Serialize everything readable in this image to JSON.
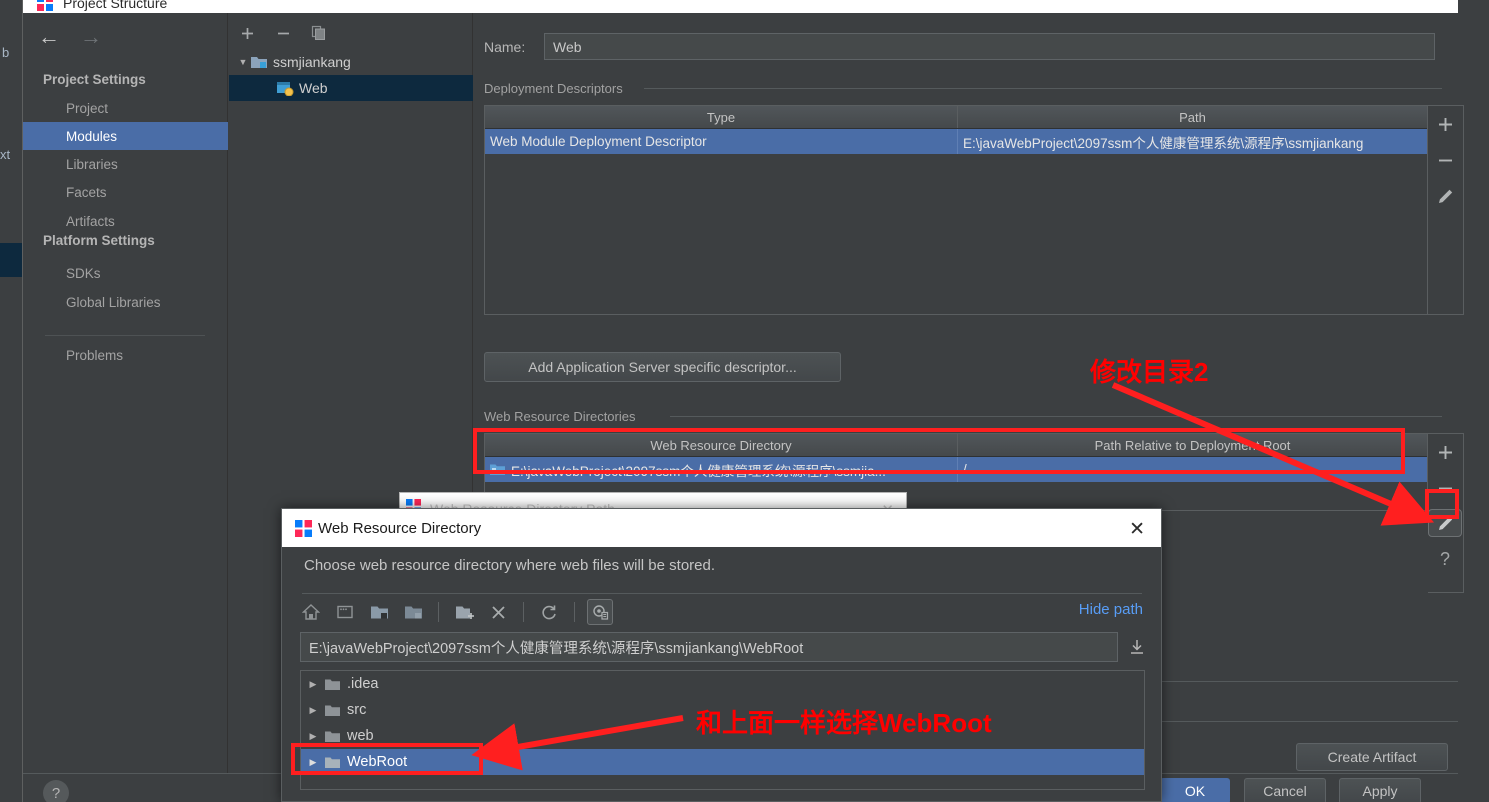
{
  "window": {
    "title": "Project Structure",
    "title_icon": "intellij-logo-icon"
  },
  "background_slivers": {
    "text_b": "b",
    "text_xt": "xt"
  },
  "nav": {
    "back_icon": "arrow-left-icon",
    "forward_icon": "arrow-right-icon",
    "groups": [
      {
        "label": "Project Settings"
      },
      {
        "label": "Platform Settings"
      }
    ],
    "items": [
      {
        "label": "Project",
        "selected": false
      },
      {
        "label": "Modules",
        "selected": true
      },
      {
        "label": "Libraries",
        "selected": false
      },
      {
        "label": "Facets",
        "selected": false
      },
      {
        "label": "Artifacts",
        "selected": false
      },
      {
        "label": "SDKs",
        "selected": false
      },
      {
        "label": "Global Libraries",
        "selected": false
      },
      {
        "label": "Problems",
        "selected": false
      }
    ]
  },
  "modules_panel": {
    "toolbar": [
      {
        "icon": "add-icon",
        "label": "+"
      },
      {
        "icon": "remove-icon",
        "label": "−"
      },
      {
        "icon": "copy-icon",
        "label": ""
      }
    ],
    "tree": [
      {
        "label": "ssmjiankang",
        "icon": "module-folder-icon",
        "expanded": true,
        "selected": false
      },
      {
        "label": "Web",
        "icon": "web-facet-icon",
        "expanded": false,
        "selected": true
      }
    ]
  },
  "content": {
    "name_label": "Name:",
    "name_value": "Web",
    "deployment_descriptors": {
      "section_label": "Deployment Descriptors",
      "columns": [
        "Type",
        "Path"
      ],
      "rows": [
        {
          "type": "Web Module Deployment Descriptor",
          "path": "E:\\javaWebProject\\2097ssm个人健康管理系统\\源程序\\ssmjiankang",
          "selected": true
        }
      ],
      "side_buttons": [
        {
          "icon": "plus-icon",
          "label": "+"
        },
        {
          "icon": "minus-icon",
          "label": "−"
        },
        {
          "icon": "pencil-icon",
          "label": ""
        }
      ]
    },
    "add_descriptor_button": "Add Application Server specific descriptor...",
    "web_resource_directories": {
      "section_label": "Web Resource Directories",
      "columns": [
        "Web Resource Directory",
        "Path Relative to Deployment Root"
      ],
      "rows": [
        {
          "directory": "E:\\javaWebProject\\2097ssm个人健康管理系统\\源程序\\ssmjia...",
          "relative_path": "/",
          "selected": true
        }
      ],
      "side_buttons": [
        {
          "icon": "plus-icon",
          "label": "+"
        },
        {
          "icon": "minus-icon",
          "label": "−"
        },
        {
          "icon": "pencil-icon",
          "label": ""
        },
        {
          "icon": "help-icon",
          "label": "?"
        }
      ]
    },
    "create_artifact_button": "Create Artifact"
  },
  "footer": {
    "help_icon": "question-circle-icon",
    "ok_button": "OK",
    "cancel_button": "Cancel",
    "apply_button": "Apply"
  },
  "background_dialog": {
    "title": "Web Resource Directory Path",
    "close_icon": "close-icon"
  },
  "web_resource_dialog": {
    "title": "Web Resource Directory",
    "title_icon": "intellij-logo-icon",
    "close_icon": "close-icon",
    "subtitle": "Choose web resource directory where web files will be stored.",
    "toolbar": [
      {
        "icon": "home-icon"
      },
      {
        "icon": "desktop-icon"
      },
      {
        "icon": "project-folder-icon"
      },
      {
        "icon": "module-folder-icon"
      },
      {
        "icon": "new-folder-icon"
      },
      {
        "icon": "delete-icon"
      },
      {
        "icon": "refresh-icon"
      },
      {
        "icon": "show-hidden-icon"
      }
    ],
    "hide_path_link": "Hide path",
    "path_value": "E:\\javaWebProject\\2097ssm个人健康管理系统\\源程序\\ssmjiankang\\WebRoot",
    "path_dropdown_icon": "download-arrow-icon",
    "tree": [
      {
        "label": ".idea",
        "selected": false
      },
      {
        "label": "src",
        "selected": false
      },
      {
        "label": "web",
        "selected": false
      },
      {
        "label": "WebRoot",
        "selected": true
      }
    ]
  },
  "annotations": {
    "color": "#ff0000",
    "note_1": "修改目录2",
    "note_2": "和上面一样选择WebRoot"
  }
}
